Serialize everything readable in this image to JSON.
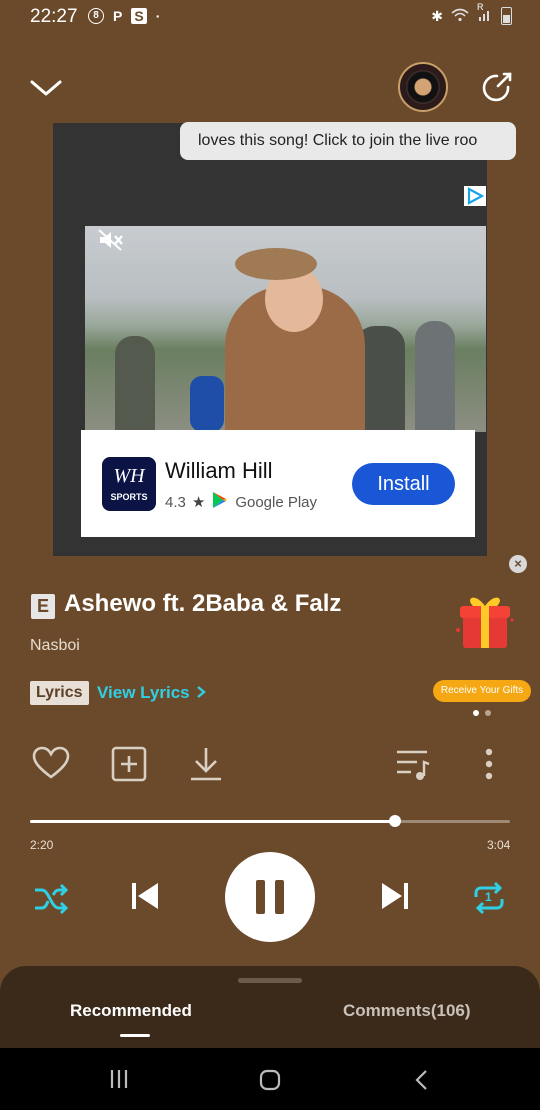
{
  "status_bar": {
    "time": "22:27",
    "left_icons": [
      "8",
      "P",
      "S",
      "·"
    ],
    "signal": "R"
  },
  "tooltip": {
    "text": "loves this song! Click to join the live roo"
  },
  "ad": {
    "app_name": "William Hill",
    "logo_text": "WH",
    "logo_sub": "SPORTS",
    "rating": "4.3",
    "store": "Google Play",
    "install_label": "Install",
    "close_label": "×"
  },
  "song": {
    "explicit_badge": "E",
    "title": "Ashewo ft. 2Baba & Falz",
    "artist": "Nasboi",
    "lyrics_tag": "Lyrics",
    "view_lyrics": "View Lyrics"
  },
  "gift": {
    "badge": "Receive Your Gifts"
  },
  "player": {
    "current_time": "2:20",
    "total_time": "3:04",
    "progress_fraction": 0.76,
    "repeat_count": "1"
  },
  "tabs": {
    "recommended": "Recommended",
    "comments": "Comments(106)"
  },
  "colors": {
    "background": "#6b4a2b",
    "accent": "#2fd0e6",
    "install": "#1a57d6",
    "gift_badge": "#f5a814"
  }
}
